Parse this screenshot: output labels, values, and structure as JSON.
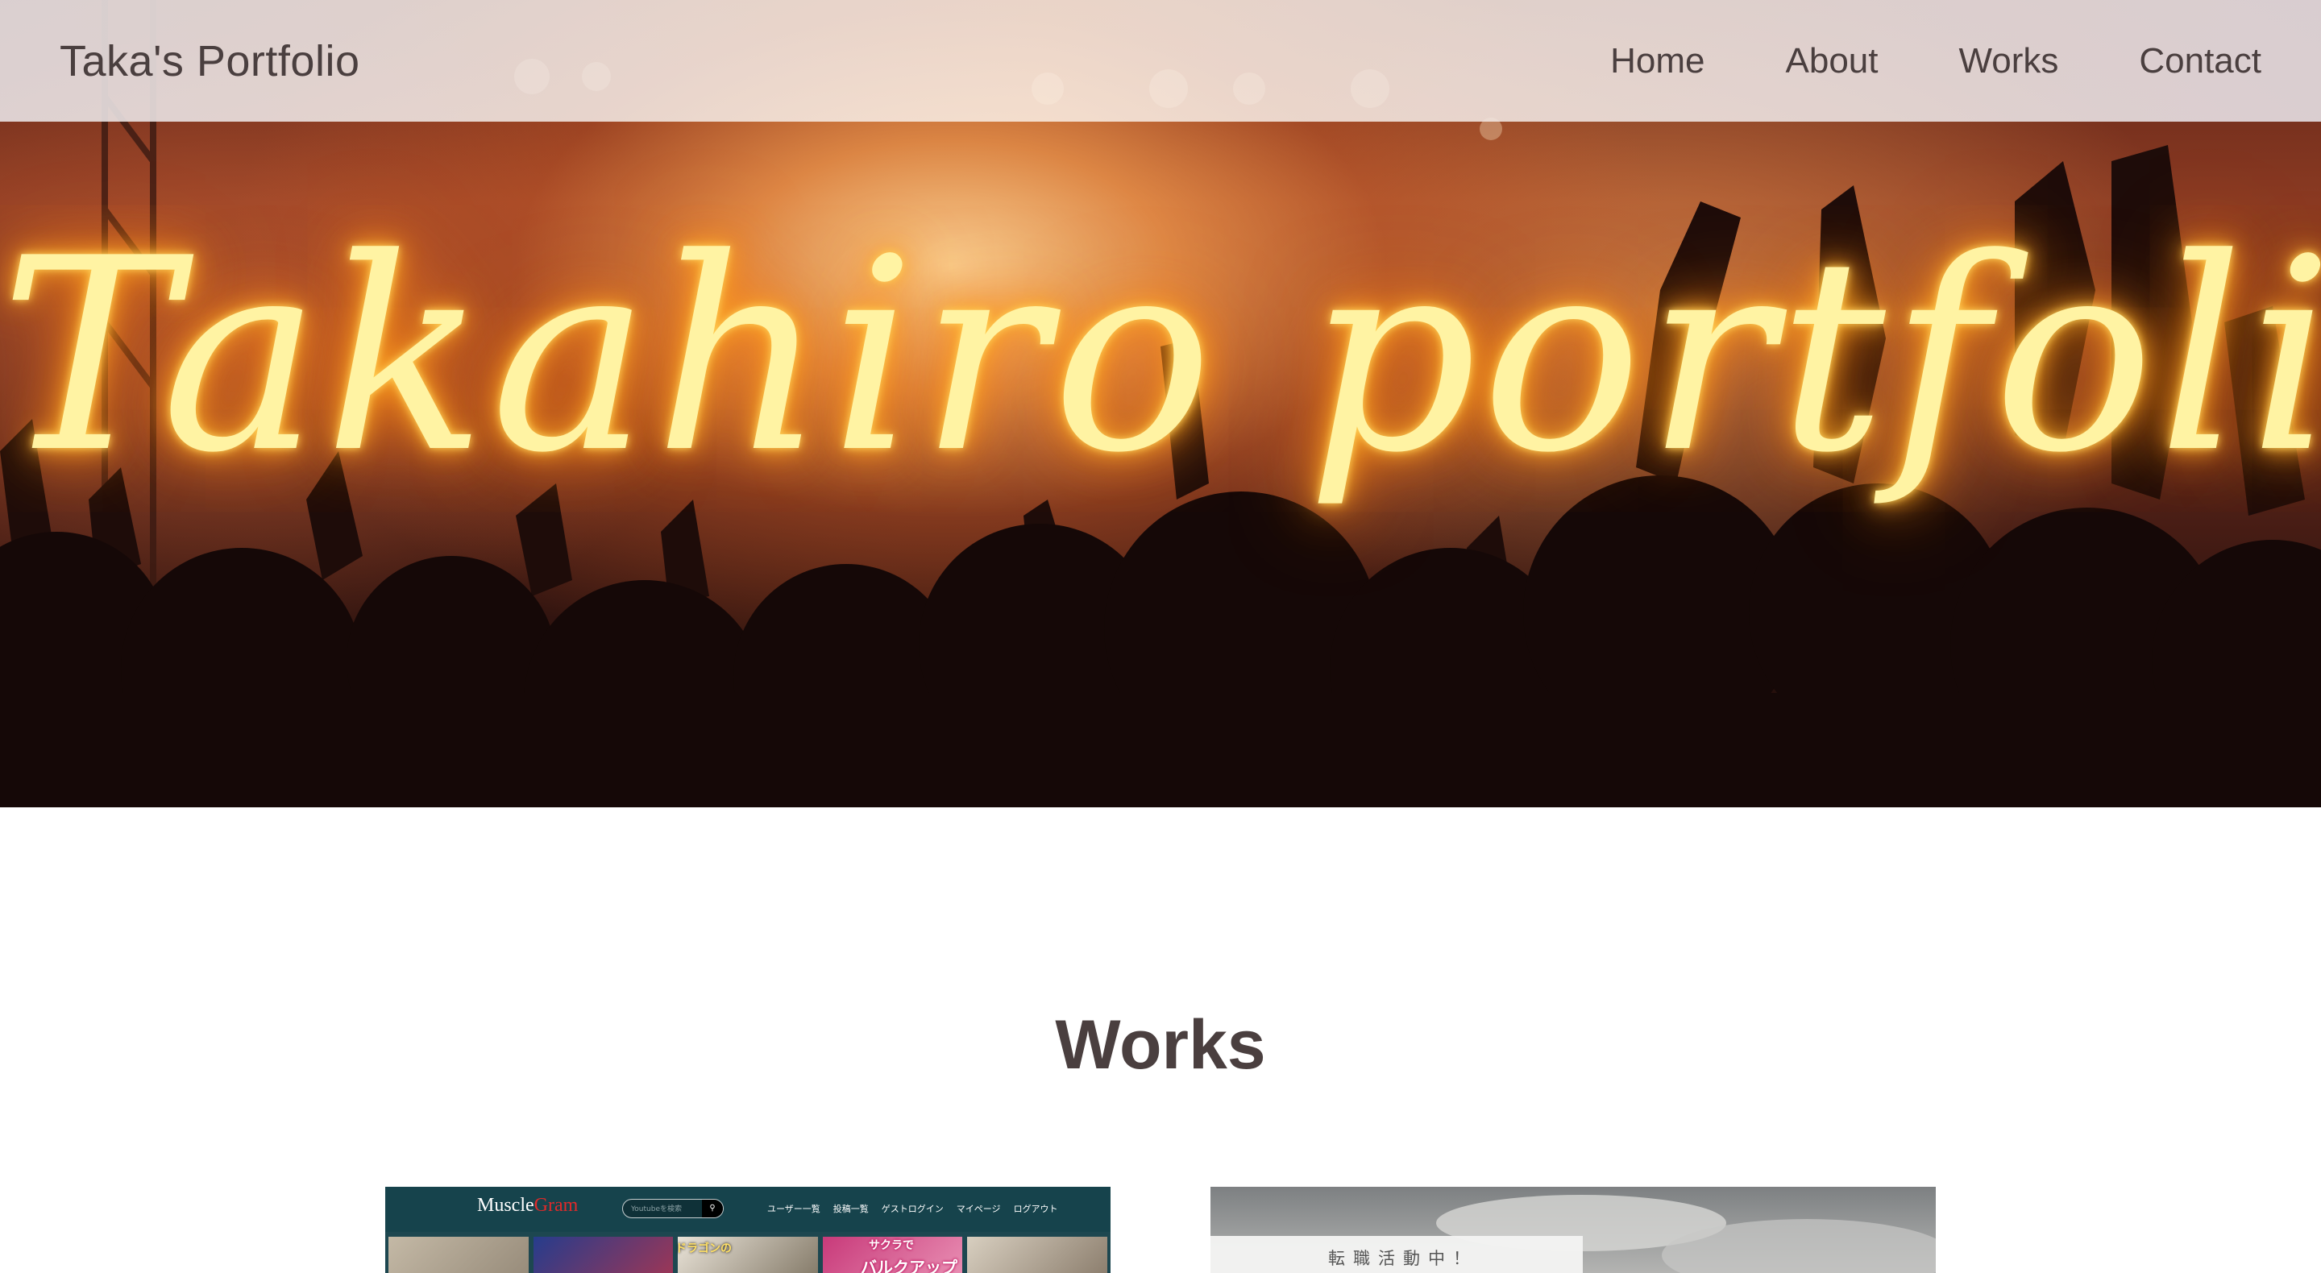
{
  "header": {
    "brand": "Taka's Portfolio",
    "nav": [
      "Home",
      "About",
      "Works",
      "Contact"
    ]
  },
  "hero": {
    "title": "Takahiro portfolio",
    "background": "concert crowd with raised hands under warm stage lights"
  },
  "works": {
    "heading": "Works",
    "items": [
      {
        "logo_main": "Muscle",
        "logo_accent": "Gram",
        "search_placeholder": "Youtubeを検索",
        "search_icon": "search-icon",
        "menu": [
          "ユーザー一覧",
          "投稿一覧",
          "ゲストログイン",
          "マイページ",
          "ログアウト"
        ],
        "thumb_text_1": "ドラゴンの",
        "thumb_text_2": "サクラで",
        "thumb_text_3": "バルクアップ"
      },
      {
        "banner_text": "転職活動中！"
      }
    ]
  },
  "colors": {
    "text": "#4a3f3f",
    "hero_title": "#fff3a3",
    "glow": "#ff8c14",
    "card1_header": "#16434c",
    "accent_red": "#e02a2a"
  }
}
